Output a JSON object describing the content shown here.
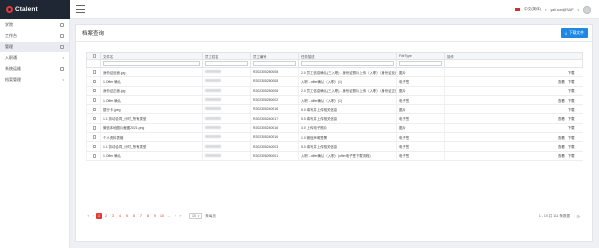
{
  "brand": {
    "name": "Ctalent"
  },
  "topbar": {
    "language": "中文(简体)",
    "user": "yali.sun@SAP"
  },
  "sidebar": {
    "items": [
      {
        "label": "学院",
        "active": false,
        "has_children": false
      },
      {
        "label": "工作台",
        "active": false,
        "has_children": false
      },
      {
        "label": "管理",
        "active": true,
        "has_children": false
      },
      {
        "label": "入职通",
        "active": false,
        "has_children": true
      },
      {
        "label": "系统运维",
        "active": false,
        "has_children": false
      },
      {
        "label": "档案管理",
        "active": false,
        "has_children": true
      }
    ]
  },
  "page": {
    "title": "档案查询",
    "download_button": "下载文件"
  },
  "table": {
    "columns": [
      "",
      "文件名",
      "员工姓名",
      "员工编号",
      "任务描述",
      "FileType",
      "操作"
    ],
    "rows": [
      {
        "file": "身份证反面.jpg",
        "emp_no": "R202305250008",
        "task": "2.0 员工信息确认(三入职) - 身份证照片上传（入职）（身份证反面）",
        "type": "图片",
        "ops": [
          "下载"
        ]
      },
      {
        "file": "1.Offer 确认",
        "emp_no": "R202305250008",
        "task": "入职 - offer确认（入职）(1)",
        "type": "电子签",
        "ops": [
          "查看",
          "下载"
        ]
      },
      {
        "file": "身份证正面.jpg",
        "emp_no": "R202305250008",
        "task": "2.0 员工信息确认(三入职) - 身份证照片上传（入职）（身份证正面）",
        "type": "图片",
        "ops": [
          "下载"
        ]
      },
      {
        "file": "1.Offer 确认",
        "emp_no": "R202305250002",
        "task": "入职 - offer确认（入职）(1)",
        "type": "电子签",
        "ops": [
          "查看",
          "下载"
        ]
      },
      {
        "file": "银行卡.jpeg",
        "emp_no": "R202305240016",
        "task": "5.0 填写并上传相关信息",
        "type": "图片",
        "ops": [
          "下载"
        ]
      },
      {
        "file": "1.1 劳动合同_计时_所有类型",
        "emp_no": "R202305240017",
        "task": "5.0 填写并上传相关信息",
        "type": "电子签",
        "ops": [
          "查看",
          "下载"
        ]
      },
      {
        "file": "微信本地图片截图2021.png",
        "emp_no": "R202305240016",
        "task": "3.0 上传电子照片",
        "type": "图片",
        "ops": [
          "下载"
        ]
      },
      {
        "file": "个人资料表格",
        "emp_no": "R202305240016",
        "task": "1.0 微信声明签署",
        "type": "电子签",
        "ops": [
          "查看",
          "下载"
        ]
      },
      {
        "file": "1.1 劳动合同_计时_所有类型",
        "emp_no": "R202305240003",
        "task": "5.0 填写并上传相关信息",
        "type": "电子签",
        "ops": [
          "查看",
          "下载"
        ]
      },
      {
        "file": "1.Offer 确认",
        "emp_no": "R202305090001",
        "task": "入职 - offer确认（入职）(offer电子签下载流程)",
        "type": "电子签",
        "ops": [
          "查看",
          "下载"
        ]
      }
    ]
  },
  "pagination": {
    "pages": [
      "1",
      "2",
      "3",
      "4",
      "5",
      "6",
      "7",
      "8",
      "9",
      "10",
      "..."
    ],
    "current": "1",
    "page_size": "10",
    "per_page_label": "条每页",
    "info": "1 - 10 共 111 条数据"
  },
  "colors": {
    "brand_dark": "#1f2634",
    "accent_red": "#e53935",
    "primary_blue": "#1e88e5"
  }
}
